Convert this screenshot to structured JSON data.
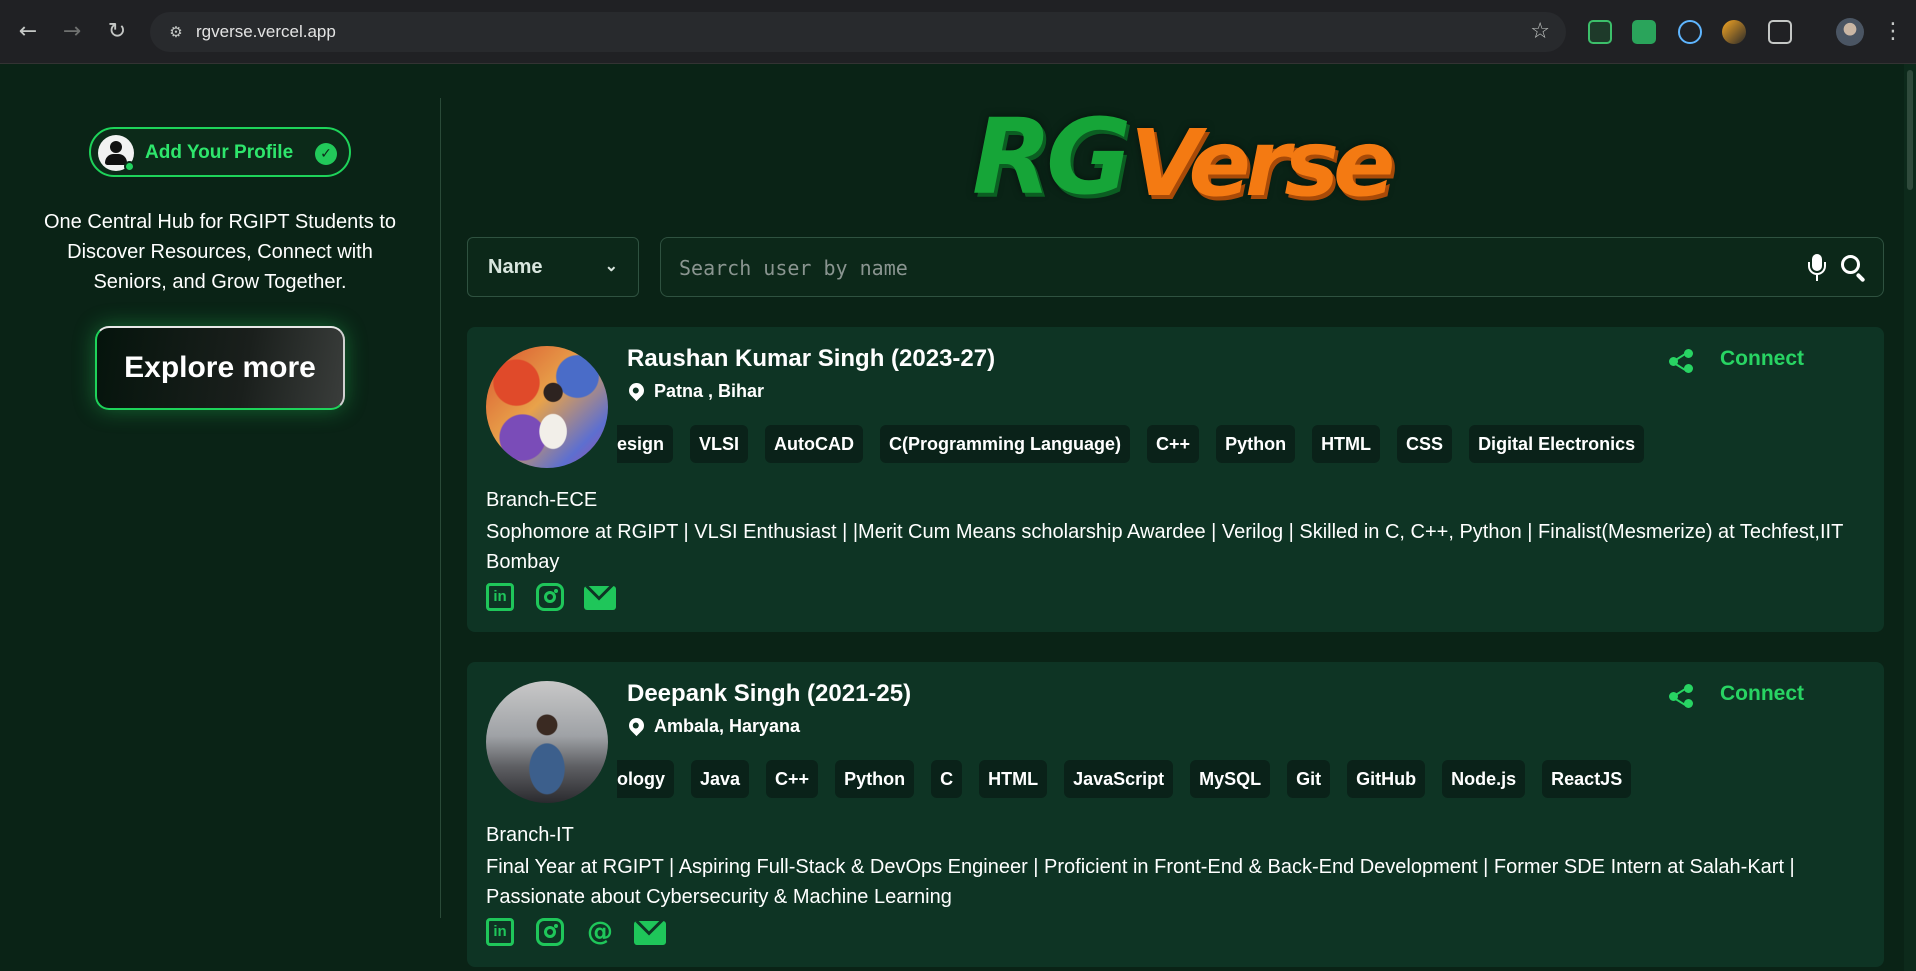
{
  "browser": {
    "url": "rgverse.vercel.app"
  },
  "sidebar": {
    "add_profile_label": "Add Your Profile",
    "tagline": "One Central Hub for RGIPT Students to Discover Resources, Connect with Seniors, and Grow Together.",
    "explore_label": "Explore more"
  },
  "logo": {
    "part1": "RG",
    "part2": "Verse"
  },
  "search": {
    "filter_value": "Name",
    "placeholder": "Search user by name"
  },
  "profiles": [
    {
      "name": "Raushan Kumar Singh (2023-27)",
      "location": "Patna , Bihar",
      "connect_label": "Connect",
      "skills": [
        "esign",
        "VLSI",
        "AutoCAD",
        "C(Programming Language)",
        "C++",
        "Python",
        "HTML",
        "CSS",
        "Digital Electronics"
      ],
      "branch": "Branch-ECE",
      "bio": "Sophomore at RGIPT | VLSI Enthusiast | |Merit Cum Means scholarship Awardee | Verilog | Skilled in C, C++, Python | Finalist(Mesmerize) at Techfest,IIT Bombay",
      "socials": [
        "linkedin-icon",
        "instagram-icon",
        "email-icon"
      ]
    },
    {
      "name": "Deepank Singh (2021-25)",
      "location": "Ambala, Haryana",
      "connect_label": "Connect",
      "skills": [
        "ology",
        "Java",
        "C++",
        "Python",
        "C",
        "HTML",
        "JavaScript",
        "MySQL",
        "Git",
        "GitHub",
        "Node.js",
        "ReactJS"
      ],
      "branch": "Branch-IT",
      "bio": "Final Year at RGIPT | Aspiring Full-Stack & DevOps Engineer | Proficient in Front-End & Back-End Development | Former SDE Intern at Salah-Kart | Passionate about Cybersecurity & Machine Learning",
      "socials": [
        "linkedin-icon",
        "instagram-icon",
        "threads-icon",
        "email-icon"
      ]
    }
  ],
  "colors": {
    "accent": "#28d463",
    "background": "#0a2316",
    "card": "#0e3424"
  }
}
